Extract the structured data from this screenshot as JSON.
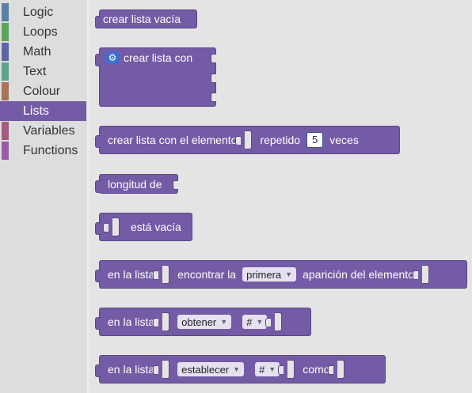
{
  "sidebar": {
    "items": [
      {
        "label": "Logic",
        "color": "#5b80a5"
      },
      {
        "label": "Loops",
        "color": "#5ba55b"
      },
      {
        "label": "Math",
        "color": "#5b67a5"
      },
      {
        "label": "Text",
        "color": "#5ba58c"
      },
      {
        "label": "Colour",
        "color": "#a5745b"
      },
      {
        "label": "Lists",
        "color": "#745ba5",
        "selected": true
      },
      {
        "label": "Variables",
        "color": "#a55b80"
      },
      {
        "label": "Functions",
        "color": "#995ba5"
      }
    ]
  },
  "blocks": {
    "create_empty": {
      "label": "crear lista vacía"
    },
    "create_with": {
      "label": "crear lista con"
    },
    "repeat": {
      "label1": "crear lista con el elemento",
      "label2": "repetido",
      "number": "5",
      "label3": "veces"
    },
    "length": {
      "label": "longitud de"
    },
    "is_empty": {
      "label": "está vacía"
    },
    "index_of": {
      "label1": "en la lista",
      "label2": "encontrar la",
      "dropdown": "primera",
      "label3": "aparición del elemento"
    },
    "get_index": {
      "label1": "en la lista",
      "dropdown1": "obtener",
      "dropdown2": "#"
    },
    "set_index": {
      "label1": "en la lista",
      "dropdown1": "establecer",
      "dropdown2": "#",
      "label2": "como"
    }
  },
  "colors": {
    "lists_block": "#745ba5",
    "workspace": "#e4e4e4",
    "sidebar": "#dddddd"
  }
}
